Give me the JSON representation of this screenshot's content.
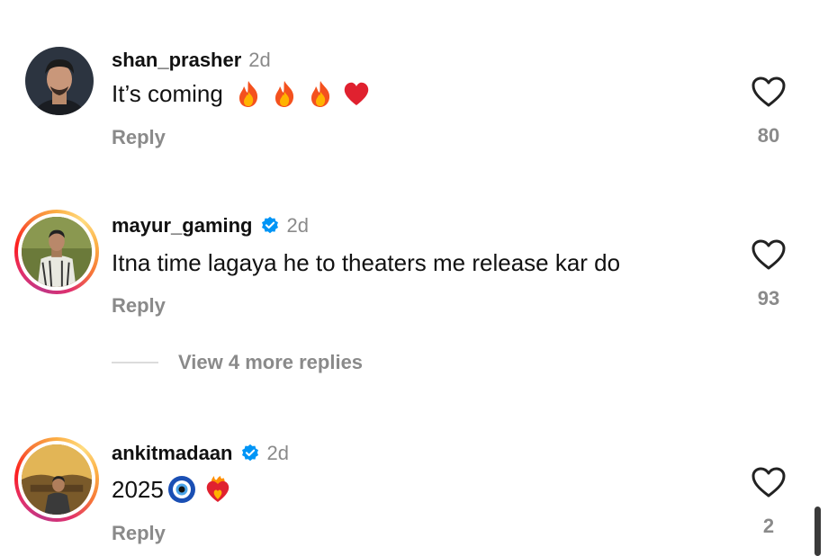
{
  "comments": [
    {
      "username": "shan_prasher",
      "time": "2d",
      "verified": false,
      "text": "It’s coming",
      "emojis": [
        "fire-emoji",
        "fire-emoji",
        "fire-emoji",
        "red-heart-emoji"
      ],
      "reply_label": "Reply",
      "likes": "80"
    },
    {
      "username": "mayur_gaming",
      "time": "2d",
      "verified": true,
      "text": "Itna time lagaya he to theaters me release kar do",
      "emojis": [],
      "reply_label": "Reply",
      "likes": "93"
    },
    {
      "username": "ankitmadaan",
      "time": "2d",
      "verified": true,
      "text": "2025",
      "emojis": [
        "nazar-amulet-emoji",
        "heart-on-fire-emoji"
      ],
      "reply_label": "Reply",
      "likes": "2"
    }
  ],
  "view_more_replies": "View 4 more replies",
  "colors": {
    "muted": "#8a8a8a",
    "verified_blue": "#0095f6",
    "scrollbar": "#3a3a3a"
  }
}
